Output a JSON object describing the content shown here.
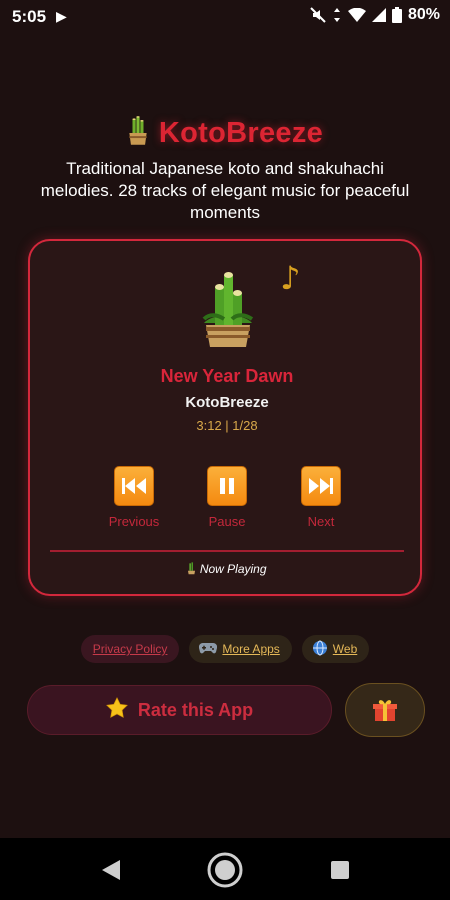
{
  "status_bar": {
    "time": "5:05",
    "battery": "80%"
  },
  "app": {
    "title": "KotoBreeze",
    "tagline": "Traditional Japanese koto and shakuhachi melodies. 28 tracks of elegant music for peaceful moments"
  },
  "player": {
    "track_title": "New Year Dawn",
    "artist": "KotoBreeze",
    "time_info": "3:12 | 1/28",
    "controls": {
      "previous": "Previous",
      "pause": "Pause",
      "next": "Next"
    },
    "status": "Now Playing"
  },
  "links": {
    "privacy": "Privacy Policy",
    "more_apps": "More Apps",
    "web": "Web"
  },
  "rate": {
    "label": "Rate this App"
  },
  "colors": {
    "accent_red": "#d9253a",
    "accent_orange": "#f48a10",
    "gold": "#d8a84a",
    "background": "#1d1010"
  }
}
